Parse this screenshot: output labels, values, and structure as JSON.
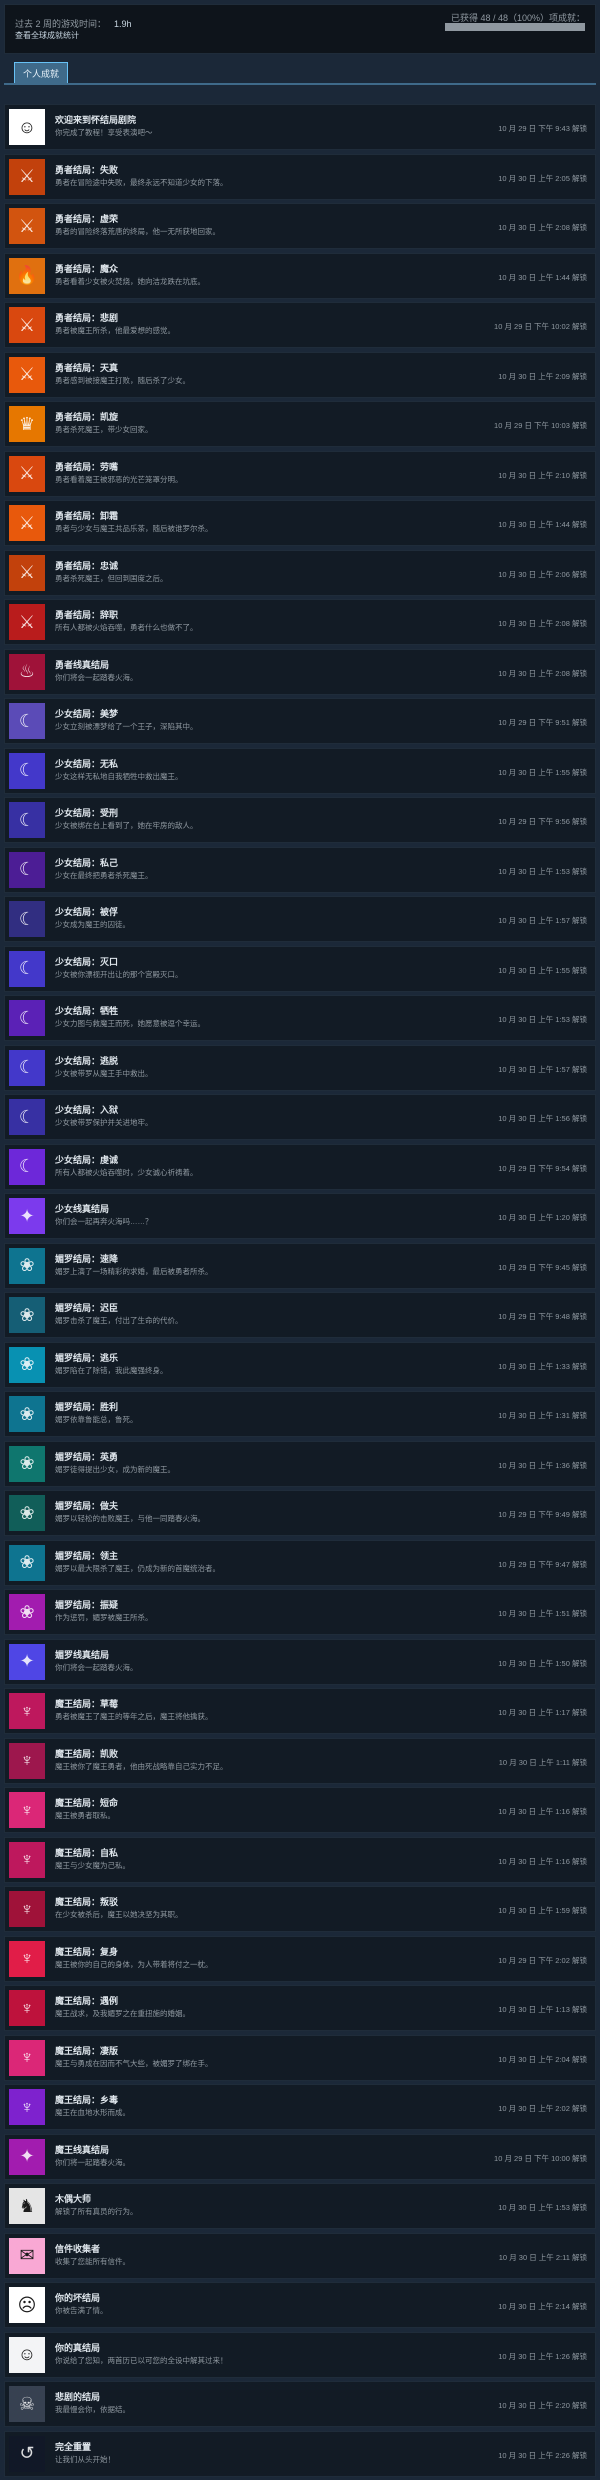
{
  "header": {
    "playtime_label": "过去 2 周的游戏时间：",
    "playtime_value": "1.9h",
    "stats_link": "查看全球成就统计",
    "progress_text": "已获得 48 / 48（100%）项成就：",
    "progress_fraction": 1.0
  },
  "tab_label": "个人成就",
  "achievements": [
    {
      "title": "欢迎来到怀结局剧院",
      "desc": "你完成了教程！享受表演吧～",
      "date": "10 月 29 日 下午 9:43 解锁",
      "color": "#ffffff",
      "icon": "mask-icon",
      "glyph": "☺"
    },
    {
      "title": "勇者结局：失败",
      "desc": "勇者在冒险途中失败，最终永远不知道少女的下落。",
      "date": "10 月 30 日 上午 2:05 解锁",
      "color": "#c2410c",
      "icon": "hero-icon",
      "glyph": "⚔"
    },
    {
      "title": "勇者结局：虚荣",
      "desc": "勇者的冒险终落荒唐的终局，他一无所获地回家。",
      "date": "10 月 30 日 上午 2:08 解锁",
      "color": "#d2540f",
      "icon": "hero-icon",
      "glyph": "⚔"
    },
    {
      "title": "勇者结局：魔众",
      "desc": "勇者看着少女被火焚烧，她向洁龙跌在坑底。",
      "date": "10 月 30 日 上午 1:44 解锁",
      "color": "#e0700f",
      "icon": "hero-icon",
      "glyph": "🔥"
    },
    {
      "title": "勇者结局：悲剧",
      "desc": "勇者被魔王所杀，他最爱想的感觉。",
      "date": "10 月 29 日 下午 10:02 解锁",
      "color": "#d9480f",
      "icon": "hero-icon",
      "glyph": "⚔"
    },
    {
      "title": "勇者结局：天真",
      "desc": "勇者感到被接魔王打败，随后杀了少女。",
      "date": "10 月 30 日 上午 2:09 解锁",
      "color": "#e8590c",
      "icon": "hero-icon",
      "glyph": "⚔"
    },
    {
      "title": "勇者结局：凯旋",
      "desc": "勇者杀死魔王，带少女回家。",
      "date": "10 月 29 日 下午 10:03 解锁",
      "color": "#e67700",
      "icon": "hero-icon",
      "glyph": "♛"
    },
    {
      "title": "勇者结局：劳嘴",
      "desc": "勇者看着魔王被邪恶的光芒笼罩分明。",
      "date": "10 月 30 日 上午 2:10 解锁",
      "color": "#d9480f",
      "icon": "hero-icon",
      "glyph": "⚔"
    },
    {
      "title": "勇者结局：卸霜",
      "desc": "勇者与少女与魔王共品乐茶，随后被谁罗尔杀。",
      "date": "10 月 30 日 上午 1:44 解锁",
      "color": "#e8590c",
      "icon": "hero-icon",
      "glyph": "⚔"
    },
    {
      "title": "勇者结局：忠诚",
      "desc": "勇者杀死魔王，但回到国度之后。",
      "date": "10 月 30 日 上午 2:06 解锁",
      "color": "#c2410c",
      "icon": "hero-icon",
      "glyph": "⚔"
    },
    {
      "title": "勇者结局：辞职",
      "desc": "所有人都被火焰吞噬，勇者什么也做不了。",
      "date": "10 月 30 日 上午 2:08 解锁",
      "color": "#b91c1c",
      "icon": "hero-icon",
      "glyph": "⚔"
    },
    {
      "title": "勇者线真结局",
      "desc": "你们将会一起踏春火海。",
      "date": "10 月 30 日 上午 2:08 解锁",
      "color": "#9f1239",
      "icon": "hero-icon",
      "glyph": "♨"
    },
    {
      "title": "少女结局：美梦",
      "desc": "少女立刻被漂梦给了一个王子，深陷其中。",
      "date": "10 月 29 日 下午 9:51 解锁",
      "color": "#5b4bb7",
      "icon": "girl-icon",
      "glyph": "☾"
    },
    {
      "title": "少女结局：无私",
      "desc": "少女这样无私地自我牺牲中救出魔王。",
      "date": "10 月 30 日 上午 1:55 解锁",
      "color": "#4338ca",
      "icon": "girl-icon",
      "glyph": "☾"
    },
    {
      "title": "少女结局：受刑",
      "desc": "少女被绑在台上看到了，她在牢房的敌人。",
      "date": "10 月 29 日 下午 9:56 解锁",
      "color": "#3730a3",
      "icon": "girl-icon",
      "glyph": "☾"
    },
    {
      "title": "少女结局：私己",
      "desc": "少女在最终把勇者杀死魔王。",
      "date": "10 月 30 日 上午 1:53 解锁",
      "color": "#4c1d95",
      "icon": "girl-icon",
      "glyph": "☾"
    },
    {
      "title": "少女结局：被俘",
      "desc": "少女成为魔王的囚徒。",
      "date": "10 月 30 日 上午 1:57 解锁",
      "color": "#312e81",
      "icon": "girl-icon",
      "glyph": "☾"
    },
    {
      "title": "少女结局：灭口",
      "desc": "少女被你漂视开出让的那个宫殿灭口。",
      "date": "10 月 30 日 上午 1:55 解锁",
      "color": "#4338ca",
      "icon": "girl-icon",
      "glyph": "☾"
    },
    {
      "title": "少女结局：牺牲",
      "desc": "少女力图与救魔王而死，她愿意被逗个幸运。",
      "date": "10 月 30 日 上午 1:53 解锁",
      "color": "#5b21b6",
      "icon": "girl-icon",
      "glyph": "☾"
    },
    {
      "title": "少女结局：逃脱",
      "desc": "少女被带罗从魔王手中救出。",
      "date": "10 月 30 日 上午 1:57 解锁",
      "color": "#4338ca",
      "icon": "girl-icon",
      "glyph": "☾"
    },
    {
      "title": "少女结局：入狱",
      "desc": "少女被带罗保护并关进地牢。",
      "date": "10 月 30 日 上午 1:56 解锁",
      "color": "#3730a3",
      "icon": "girl-icon",
      "glyph": "☾"
    },
    {
      "title": "少女结局：虔诚",
      "desc": "所有人都被火焰吞噬时，少女诚心祈祷着。",
      "date": "10 月 29 日 下午 9:54 解锁",
      "color": "#6d28d9",
      "icon": "girl-icon",
      "glyph": "☾"
    },
    {
      "title": "少女线真结局",
      "desc": "你们会一起再奔火海吗……？",
      "date": "10 月 30 日 上午 1:20 解锁",
      "color": "#7c3aed",
      "icon": "girl-icon",
      "glyph": "✦"
    },
    {
      "title": "媚罗结局：速降",
      "desc": "媚罗上演了一场精彩的求婚，最后被勇者所杀。",
      "date": "10 月 29 日 下午 9:45 解锁",
      "color": "#0e7490",
      "icon": "mira-icon",
      "glyph": "❀"
    },
    {
      "title": "媚罗结局：迟臣",
      "desc": "媚罗击杀了魔王，付出了生命的代价。",
      "date": "10 月 29 日 下午 9:48 解锁",
      "color": "#155e75",
      "icon": "mira-icon",
      "glyph": "❀"
    },
    {
      "title": "媚罗结局：逃乐",
      "desc": "媚罗陷在了除错，我此魔强终身。",
      "date": "10 月 30 日 上午 1:33 解锁",
      "color": "#0891b2",
      "icon": "mira-icon",
      "glyph": "❀"
    },
    {
      "title": "媚罗结局：胜利",
      "desc": "媚罗依靠鲁能总，鲁死。",
      "date": "10 月 30 日 上午 1:31 解锁",
      "color": "#0e7490",
      "icon": "mira-icon",
      "glyph": "❀"
    },
    {
      "title": "媚罗结局：英勇",
      "desc": "媚罗徒得提出少女，成为新的魔王。",
      "date": "10 月 30 日 上午 1:36 解锁",
      "color": "#0f766e",
      "icon": "mira-icon",
      "glyph": "❀"
    },
    {
      "title": "媚罗结局：做夫",
      "desc": "媚罗以轻松的击败魔王，与他一同踏春火海。",
      "date": "10 月 29 日 下午 9:49 解锁",
      "color": "#115e59",
      "icon": "mira-icon",
      "glyph": "❀"
    },
    {
      "title": "媚罗结局：领主",
      "desc": "媚罗以最大限杀了魔王，仍成为新的首魔统治者。",
      "date": "10 月 29 日 下午 9:47 解锁",
      "color": "#0e7490",
      "icon": "mira-icon",
      "glyph": "❀"
    },
    {
      "title": "媚罗结局：振疑",
      "desc": "作为惩罚，媚罗被魔王所杀。",
      "date": "10 月 30 日 上午 1:51 解锁",
      "color": "#a21caf",
      "icon": "mira-icon",
      "glyph": "❀"
    },
    {
      "title": "媚罗线真结局",
      "desc": "你们将会一起踏春火海。",
      "date": "10 月 30 日 上午 1:50 解锁",
      "color": "#4f46e5",
      "icon": "mira-icon",
      "glyph": "✦"
    },
    {
      "title": "魔王结局：草莓",
      "desc": "勇者被魔王了魔王的等年之后，魔王将他擒获。",
      "date": "10 月 30 日 上午 1:17 解锁",
      "color": "#be185d",
      "icon": "demon-icon",
      "glyph": "♆"
    },
    {
      "title": "魔王结局：凯败",
      "desc": "魔王被你了魔王勇者，他由死战略靠自己实力不足。",
      "date": "10 月 30 日 上午 1:11 解锁",
      "color": "#9d174d",
      "icon": "demon-icon",
      "glyph": "♆"
    },
    {
      "title": "魔王结局：短命",
      "desc": "魔王被勇者取私。",
      "date": "10 月 30 日 上午 1:16 解锁",
      "color": "#db2777",
      "icon": "demon-icon",
      "glyph": "♆"
    },
    {
      "title": "魔王结局：自私",
      "desc": "魔王与少女魔为己私。",
      "date": "10 月 30 日 上午 1:16 解锁",
      "color": "#be185d",
      "icon": "demon-icon",
      "glyph": "♆"
    },
    {
      "title": "魔王结局：叛驳",
      "desc": "在少女被杀后，魔王以她决坚为其职。",
      "date": "10 月 30 日 上午 1:59 解锁",
      "color": "#9f1239",
      "icon": "demon-icon",
      "glyph": "♆"
    },
    {
      "title": "魔王结局：复身",
      "desc": "魔王被你的自己的身体，为人带着将付之一枕。",
      "date": "10 月 29 日 下午 2:02 解锁",
      "color": "#e11d48",
      "icon": "demon-icon",
      "glyph": "♆"
    },
    {
      "title": "魔王结局：遇例",
      "desc": "魔王战求，及我媚罗之在重扭施的婚姻。",
      "date": "10 月 30 日 上午 1:13 解锁",
      "color": "#be123c",
      "icon": "demon-icon",
      "glyph": "♆"
    },
    {
      "title": "魔王结局：凄版",
      "desc": "魔王与勇成在因而不气大些，被媚罗了绑在手。",
      "date": "10 月 30 日 上午 2:04 解锁",
      "color": "#db2777",
      "icon": "demon-icon",
      "glyph": "♆"
    },
    {
      "title": "魔王结局：乡毒",
      "desc": "魔王在血地水形而成。",
      "date": "10 月 30 日 上午 2:02 解锁",
      "color": "#7e22ce",
      "icon": "demon-icon",
      "glyph": "♆"
    },
    {
      "title": "魔王线真结局",
      "desc": "你们将一起踏春火海。",
      "date": "10 月 29 日 下午 10:00 解锁",
      "color": "#a21caf",
      "icon": "demon-icon",
      "glyph": "✦"
    },
    {
      "title": "木偶大师",
      "desc": "解锁了所有真员的行为。",
      "date": "10 月 30 日 上午 1:53 解锁",
      "color": "#e5e5e5",
      "icon": "puppet-icon",
      "glyph": "♞"
    },
    {
      "title": "信件收集者",
      "desc": "收集了您能所有信件。",
      "date": "10 月 30 日 上午 2:11 解锁",
      "color": "#f9a8d4",
      "icon": "letter-icon",
      "glyph": "✉"
    },
    {
      "title": "你的坏结局",
      "desc": "你被告满了情。",
      "date": "10 月 30 日 上午 2:14 解锁",
      "color": "#ffffff",
      "icon": "mask-icon",
      "glyph": "☹"
    },
    {
      "title": "你的真结局",
      "desc": "你说给了您知，两首历已以可您的全设中解其过来！",
      "date": "10 月 30 日 上午 1:26 解锁",
      "color": "#f3f4f6",
      "icon": "mask-icon",
      "glyph": "☺"
    },
    {
      "title": "悲剧的结局",
      "desc": "我最慢会你，依据结。",
      "date": "10 月 30 日 上午 2:20 解锁",
      "color": "#374151",
      "icon": "skull-icon",
      "glyph": "☠"
    },
    {
      "title": "完全重置",
      "desc": "让我们从头开始！",
      "date": "10 月 30 日 上午 2:26 解锁",
      "color": "#111827",
      "icon": "reset-icon",
      "glyph": "↺"
    }
  ]
}
